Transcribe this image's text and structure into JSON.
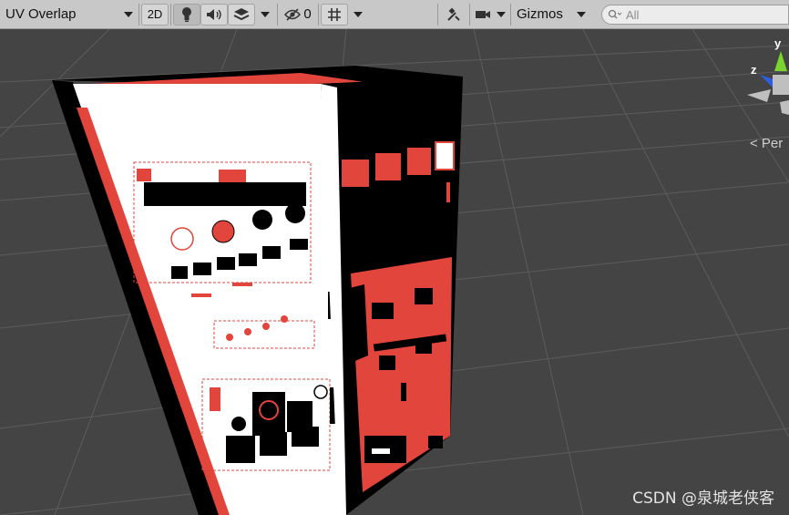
{
  "toolbar": {
    "draw_mode": "UV Overlap",
    "mode_2d": "2D",
    "hidden_count": "0",
    "gizmos": "Gizmos",
    "search_placeholder": "All"
  },
  "scene": {
    "persp_label": "< Per",
    "axis_y": "y",
    "axis_z": "z"
  },
  "watermark": "CSDN @泉城老侠客",
  "colors": {
    "background": "#444444",
    "grid": "#5a5a5a",
    "uv_red": "#e2453c",
    "uv_white": "#ffffff",
    "uv_black": "#000000",
    "gizmo_y": "#7ad32f",
    "gizmo_z": "#2d5de0"
  }
}
